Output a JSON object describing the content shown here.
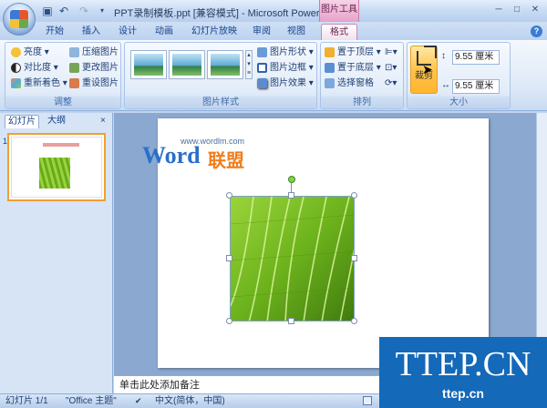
{
  "window": {
    "title": "PPT录制模板.ppt [兼容模式] - Microsoft PowerP...",
    "context_tab": "图片工具",
    "controls": [
      "minimize",
      "maximize",
      "close"
    ]
  },
  "tabs": [
    "开始",
    "插入",
    "设计",
    "动画",
    "幻灯片放映",
    "审阅",
    "视图",
    "格式"
  ],
  "active_tab": "格式",
  "ribbon": {
    "adjust": {
      "label": "调整",
      "items": [
        "亮度",
        "对比度",
        "重新着色",
        "压缩图片",
        "更改图片",
        "重设图片"
      ]
    },
    "picture_styles": {
      "label": "图片样式",
      "items": [
        "图片形状",
        "图片边框",
        "图片效果"
      ]
    },
    "arrange": {
      "label": "排列",
      "items": [
        "置于顶层",
        "置于底层",
        "选择窗格"
      ]
    },
    "size": {
      "label": "大小",
      "crop_label": "裁剪",
      "height": "9.55 厘米",
      "width": "9.55 厘米"
    }
  },
  "panel": {
    "tabs": [
      "幻灯片",
      "大纲"
    ],
    "close": "×",
    "slide_number": "1"
  },
  "slide": {
    "brand_url": "www.wordlm.com",
    "brand_word": "Word",
    "brand_cn": "联盟"
  },
  "notes_placeholder": "单击此处添加备注",
  "status": {
    "slide": "幻灯片 1/1",
    "theme": "\"Office 主题\"",
    "language": "中文(简体，中国)"
  },
  "watermark": {
    "big": "TTEP.CN",
    "small": "ttep.cn"
  },
  "colors": {
    "accent_pink": "#e6a2c9",
    "ribbon_blue": "#dce8f7",
    "watermark_blue": "#1469b8",
    "brand_blue": "#2a6fc9",
    "brand_orange": "#f07d1e"
  }
}
